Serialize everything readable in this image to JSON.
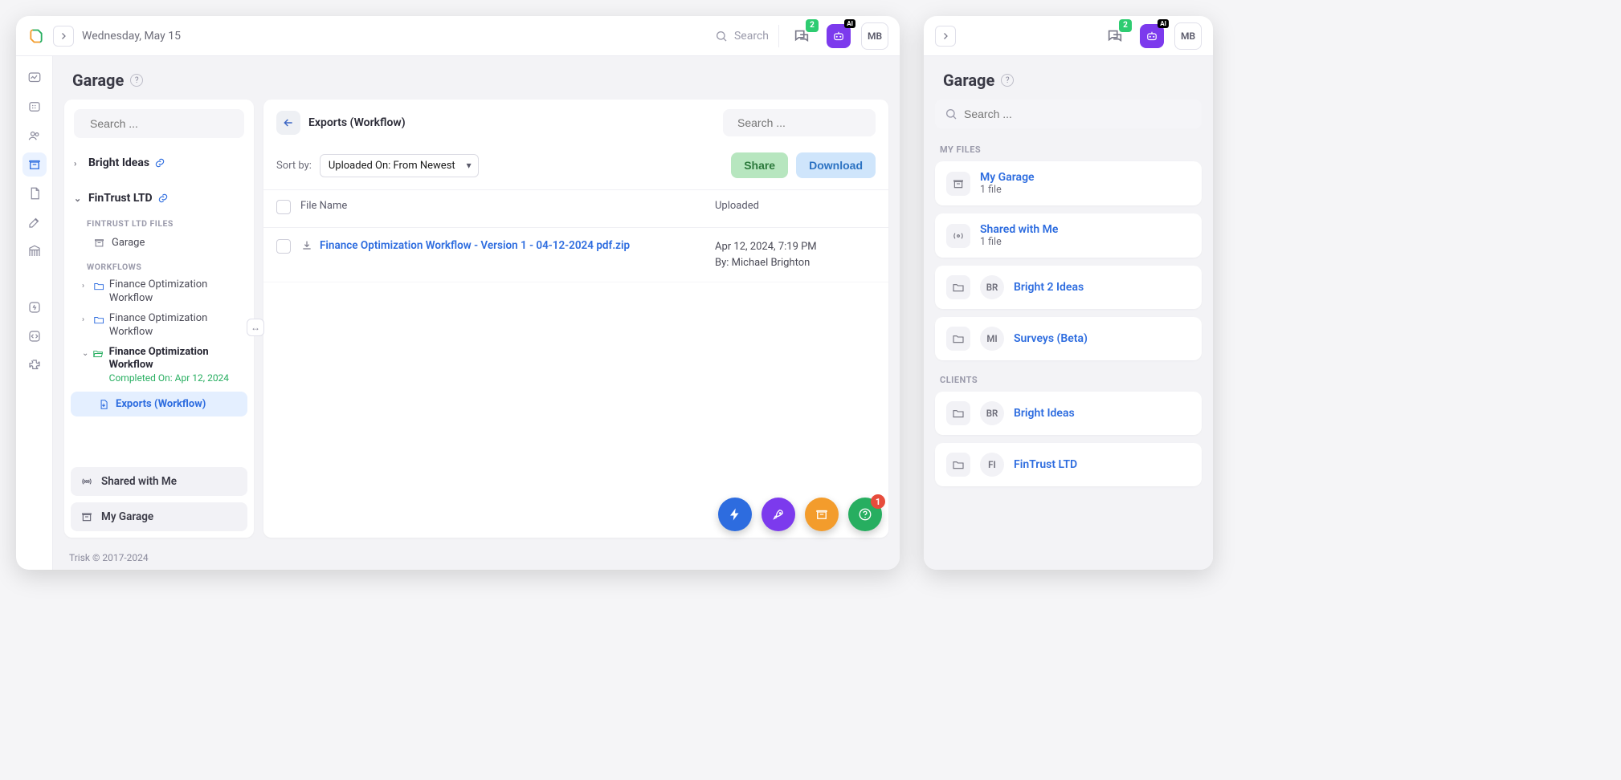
{
  "date": "Wednesday, May 15",
  "search_placeholder": "Search",
  "chat_badge": "2",
  "ai_badge": "AI",
  "user_initials": "MB",
  "page_title": "Garage",
  "left_search_placeholder": "Search ...",
  "tree": {
    "group1": "Bright Ideas",
    "group2": "FinTrust LTD",
    "files_label": "FINTRUST LTD FILES",
    "garage_item": "Garage",
    "workflows_label": "WORKFLOWS",
    "wf1": "Finance Optimization Workflow",
    "wf2": "Finance Optimization Workflow",
    "wf3": "Finance Optimization Workflow",
    "wf3_sub": "Completed On: Apr 12, 2024",
    "exports": "Exports (Workflow)"
  },
  "bottom": {
    "shared": "Shared with Me",
    "my_garage": "My Garage"
  },
  "right": {
    "breadcrumb": "Exports (Workflow)",
    "search_placeholder": "Search ...",
    "sort_label": "Sort by:",
    "sort_value": "Uploaded On: From Newest",
    "share": "Share",
    "download": "Download",
    "col_file": "File Name",
    "col_uploaded": "Uploaded",
    "file_name": "Finance Optimization Workflow - Version 1 - 04-12-2024 pdf.zip",
    "uploaded_at": "Apr 12, 2024, 7:19 PM",
    "uploaded_by": "By: Michael Brighton"
  },
  "help_badge": "1",
  "footer": "Trisk © 2017-2024",
  "secondary": {
    "chat_badge": "2",
    "ai_badge": "AI",
    "user_initials": "MB",
    "page_title": "Garage",
    "search_placeholder": "Search ...",
    "my_files_label": "MY FILES",
    "clients_label": "CLIENTS",
    "cards": {
      "my_garage": {
        "title": "My Garage",
        "sub": "1 file"
      },
      "shared": {
        "title": "Shared with Me",
        "sub": "1 file"
      },
      "b2i": {
        "abbr": "BR",
        "title": "Bright 2 Ideas"
      },
      "surveys": {
        "abbr": "MI",
        "title": "Surveys (Beta)"
      },
      "bright": {
        "abbr": "BR",
        "title": "Bright Ideas"
      },
      "fintrust": {
        "abbr": "FI",
        "title": "FinTrust LTD"
      }
    }
  }
}
